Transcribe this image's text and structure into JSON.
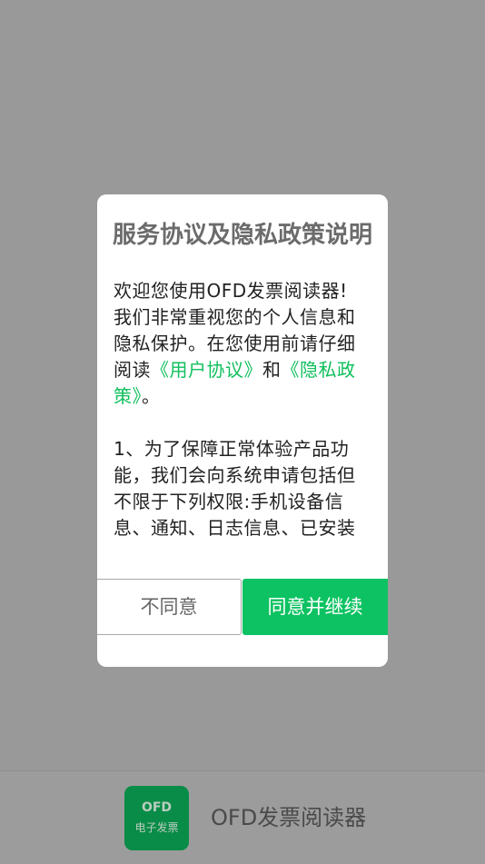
{
  "dialog": {
    "title": "服务协议及隐私政策说明",
    "intro_line1": "欢迎您使用OFD发票阅读器!",
    "intro_line2_a": "我们非常重视您的个人信息和隐私保护。在您使用前请仔细阅读",
    "user_agreement_link": "《用户协议》",
    "and_word": "和",
    "privacy_policy_link": "《隐私政策》",
    "period": "。",
    "clause_1": "1、为了保障正常体验产品功能，我们会向系统申请包括但不限于下列权限:手机设备信息、通知、日志信息、已安装应用列表等",
    "disagree_label": "不同意",
    "agree_label": "同意并继续"
  },
  "footer": {
    "logo_top": "OFD",
    "logo_bottom": "电子发票",
    "app_name": "OFD发票阅读器"
  },
  "colors": {
    "overlay": "#999999",
    "accent_green": "#0dc262",
    "link_green": "#0fbf5c"
  }
}
